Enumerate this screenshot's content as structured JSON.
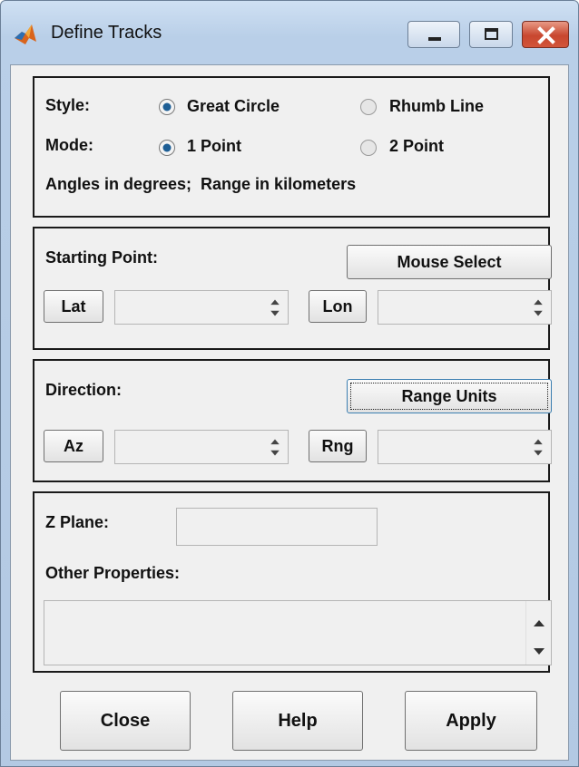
{
  "window": {
    "title": "Define Tracks",
    "icon": "matlab-icon",
    "controls": [
      "minimize-icon",
      "maximize-icon",
      "close-icon"
    ]
  },
  "style_panel": {
    "style_label": "Style:",
    "style_options": [
      {
        "label": "Great Circle",
        "selected": true
      },
      {
        "label": "Rhumb Line",
        "selected": false
      }
    ],
    "mode_label": "Mode:",
    "mode_options": [
      {
        "label": "1 Point",
        "selected": true
      },
      {
        "label": "2 Point",
        "selected": false
      }
    ],
    "units_note": "Angles in degrees;  Range in kilometers"
  },
  "starting_point_panel": {
    "label": "Starting Point:",
    "mouse_select_button": "Mouse Select",
    "lat_button": "Lat",
    "lat_value": "",
    "lon_button": "Lon",
    "lon_value": ""
  },
  "direction_panel": {
    "label": "Direction:",
    "range_units_button": "Range Units",
    "az_button": "Az",
    "az_value": "",
    "rng_button": "Rng",
    "rng_value": ""
  },
  "zplane_panel": {
    "zplane_label": "Z Plane:",
    "zplane_value": "",
    "other_properties_label": "Other Properties:",
    "other_properties_value": ""
  },
  "footer": {
    "close_button": "Close",
    "help_button": "Help",
    "apply_button": "Apply"
  }
}
